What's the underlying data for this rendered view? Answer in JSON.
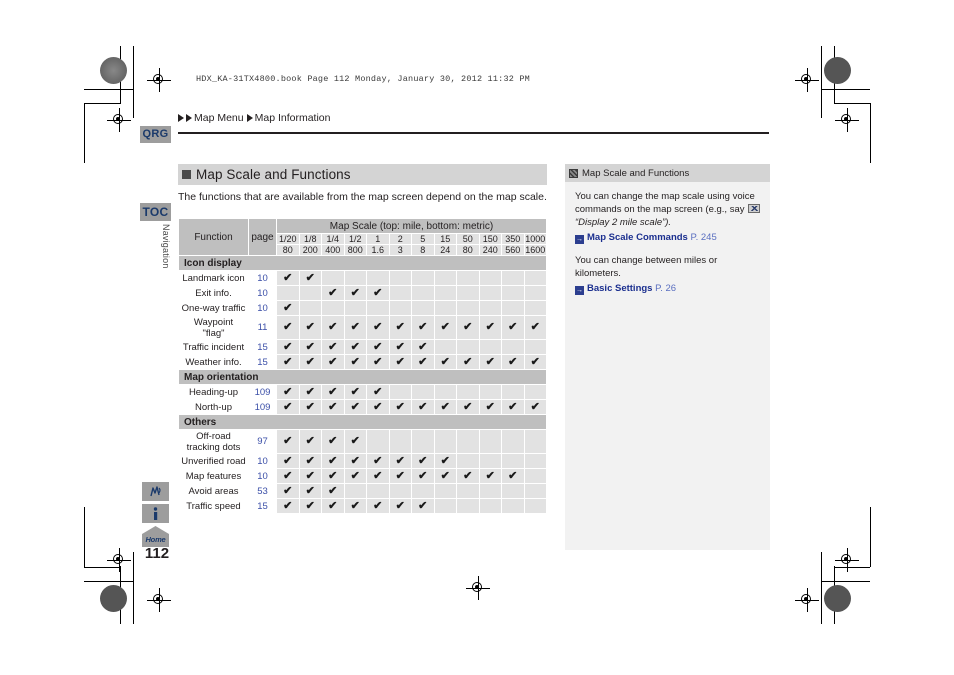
{
  "print_header": "HDX_KA-31TX4800.book  Page 112  Monday, January 30, 2012  11:32 PM",
  "breadcrumb": {
    "items": [
      "Map Menu",
      "Map Information"
    ]
  },
  "rail": {
    "qrg_label": "QRG",
    "toc_label": "TOC",
    "vertical_label": "Navigation",
    "home_label": "Home",
    "page_number": "112",
    "icons": {
      "voice": "voice-command-icon",
      "info": "information-icon",
      "home": "home-icon"
    }
  },
  "section": {
    "title": "Map Scale and Functions",
    "intro": "The functions that are available from the map screen depend on the map scale."
  },
  "table": {
    "header": {
      "function": "Function",
      "page": "page",
      "scale_span": "Map Scale (top: mile, bottom: metric)",
      "mile": [
        "1/20",
        "1/8",
        "1/4",
        "1/2",
        "1",
        "2",
        "5",
        "15",
        "50",
        "150",
        "350",
        "1000"
      ],
      "metric": [
        "80",
        "200",
        "400",
        "800",
        "1.6",
        "3",
        "8",
        "24",
        "80",
        "240",
        "560",
        "1600"
      ]
    },
    "groups": [
      {
        "label": "Icon display",
        "rows": [
          {
            "name": "Landmark icon",
            "page": "10",
            "marks": [
              1,
              1,
              0,
              0,
              0,
              0,
              0,
              0,
              0,
              0,
              0,
              0
            ],
            "tall": false
          },
          {
            "name": "Exit info.",
            "page": "10",
            "marks": [
              0,
              0,
              1,
              1,
              1,
              0,
              0,
              0,
              0,
              0,
              0,
              0
            ],
            "tall": false
          },
          {
            "name": "One-way traffic",
            "page": "10",
            "marks": [
              1,
              0,
              0,
              0,
              0,
              0,
              0,
              0,
              0,
              0,
              0,
              0
            ],
            "tall": false
          },
          {
            "name": "Waypoint\n\"flag\"",
            "page": "11",
            "marks": [
              1,
              1,
              1,
              1,
              1,
              1,
              1,
              1,
              1,
              1,
              1,
              1
            ],
            "tall": true
          },
          {
            "name": "Traffic incident",
            "page": "15",
            "marks": [
              1,
              1,
              1,
              1,
              1,
              1,
              1,
              0,
              0,
              0,
              0,
              0
            ],
            "tall": false
          },
          {
            "name": "Weather info.",
            "page": "15",
            "marks": [
              1,
              1,
              1,
              1,
              1,
              1,
              1,
              1,
              1,
              1,
              1,
              1
            ],
            "tall": false
          }
        ]
      },
      {
        "label": "Map orientation",
        "rows": [
          {
            "name": "Heading-up",
            "page": "109",
            "marks": [
              1,
              1,
              1,
              1,
              1,
              0,
              0,
              0,
              0,
              0,
              0,
              0
            ],
            "tall": false
          },
          {
            "name": "North-up",
            "page": "109",
            "marks": [
              1,
              1,
              1,
              1,
              1,
              1,
              1,
              1,
              1,
              1,
              1,
              1
            ],
            "tall": false
          }
        ]
      },
      {
        "label": "Others",
        "rows": [
          {
            "name": "Off-road\ntracking dots",
            "page": "97",
            "marks": [
              1,
              1,
              1,
              1,
              0,
              0,
              0,
              0,
              0,
              0,
              0,
              0
            ],
            "tall": true
          },
          {
            "name": "Unverified road",
            "page": "10",
            "marks": [
              1,
              1,
              1,
              1,
              1,
              1,
              1,
              1,
              0,
              0,
              0,
              0
            ],
            "tall": false
          },
          {
            "name": "Map features",
            "page": "10",
            "marks": [
              1,
              1,
              1,
              1,
              1,
              1,
              1,
              1,
              1,
              1,
              1,
              0
            ],
            "tall": false
          },
          {
            "name": "Avoid areas",
            "page": "53",
            "marks": [
              1,
              1,
              1,
              0,
              0,
              0,
              0,
              0,
              0,
              0,
              0,
              0
            ],
            "tall": false
          },
          {
            "name": "Traffic speed",
            "page": "15",
            "marks": [
              1,
              1,
              1,
              1,
              1,
              1,
              1,
              0,
              0,
              0,
              0,
              0
            ],
            "tall": false
          }
        ]
      }
    ]
  },
  "side_panel": {
    "title": "Map Scale and Functions",
    "para1_a": "You can change the map scale using voice commands on the map screen (e.g., say ",
    "para1_b": "“Display 2 mile scale”).",
    "ref1_title": "Map Scale Commands",
    "ref1_page": "P. 245",
    "para2": "You can change between miles or kilometers.",
    "ref2_title": "Basic Settings",
    "ref2_page": "P. 26"
  },
  "colors": {
    "header_gray": "#bfbfbf",
    "cell_gray": "#e2e2e2",
    "title_bar": "#d4d4d4",
    "link_blue": "#1b2f8f",
    "page_link": "#3b4fa8",
    "tab_gray": "#9d9d9d"
  }
}
